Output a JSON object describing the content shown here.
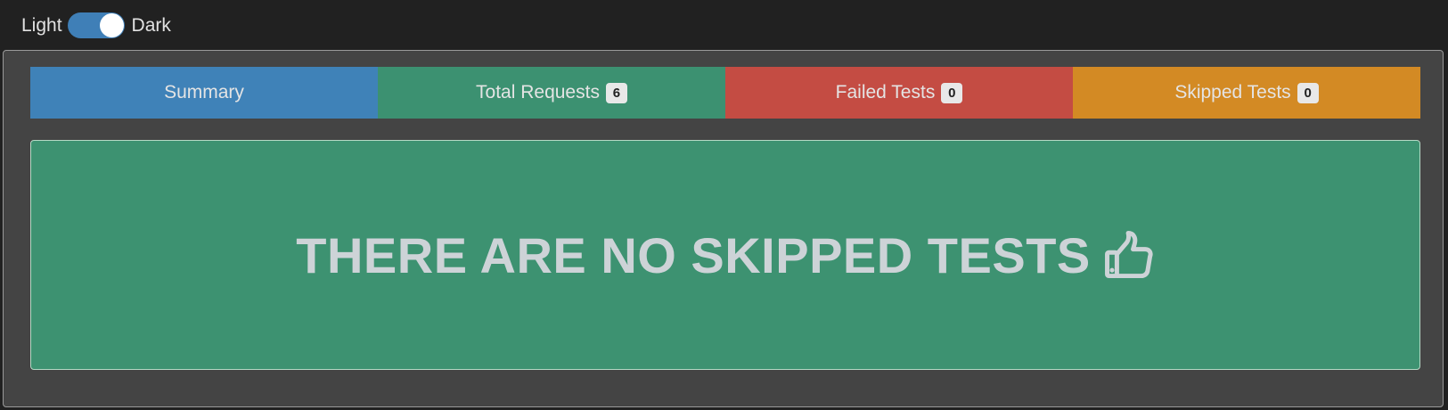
{
  "theme_switch": {
    "light_label": "Light",
    "dark_label": "Dark",
    "track_color": "#3f7fb7"
  },
  "tabs": [
    {
      "label": "Summary",
      "badge": "",
      "color": "#3f82b8"
    },
    {
      "label": "Total Requests",
      "badge": "6",
      "color": "#3c9171"
    },
    {
      "label": "Failed Tests",
      "badge": "0",
      "color": "#c44c43"
    },
    {
      "label": "Skipped Tests",
      "badge": "0",
      "color": "#d38a24"
    }
  ],
  "message": {
    "text": "THERE ARE NO SKIPPED TESTS",
    "icon": "thumbs-up-icon",
    "background": "#3d9271"
  },
  "colors": {
    "page_background": "#212121",
    "panel_background": "#444444"
  }
}
